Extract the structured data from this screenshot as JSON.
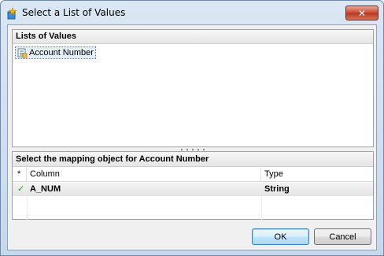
{
  "window": {
    "title": "Select a List of Values",
    "close_glyph": "✕",
    "icon": "tool-wizard-icon"
  },
  "lov_panel": {
    "header": "Lists of Values",
    "items": [
      {
        "label": "Account Number",
        "icon": "list-of-values-icon",
        "selected": true
      }
    ]
  },
  "mapping_panel": {
    "header": "Select the mapping object for  Account Number",
    "columns": [
      "*",
      "Column",
      "Type"
    ],
    "rows": [
      {
        "mark": "✓",
        "column": "A_NUM",
        "type": "String"
      }
    ]
  },
  "buttons": {
    "ok": "OK",
    "cancel": "Cancel"
  },
  "colors": {
    "check": "#2f9a2f",
    "accent": "#3c7fb1",
    "close": "#c7472f"
  }
}
